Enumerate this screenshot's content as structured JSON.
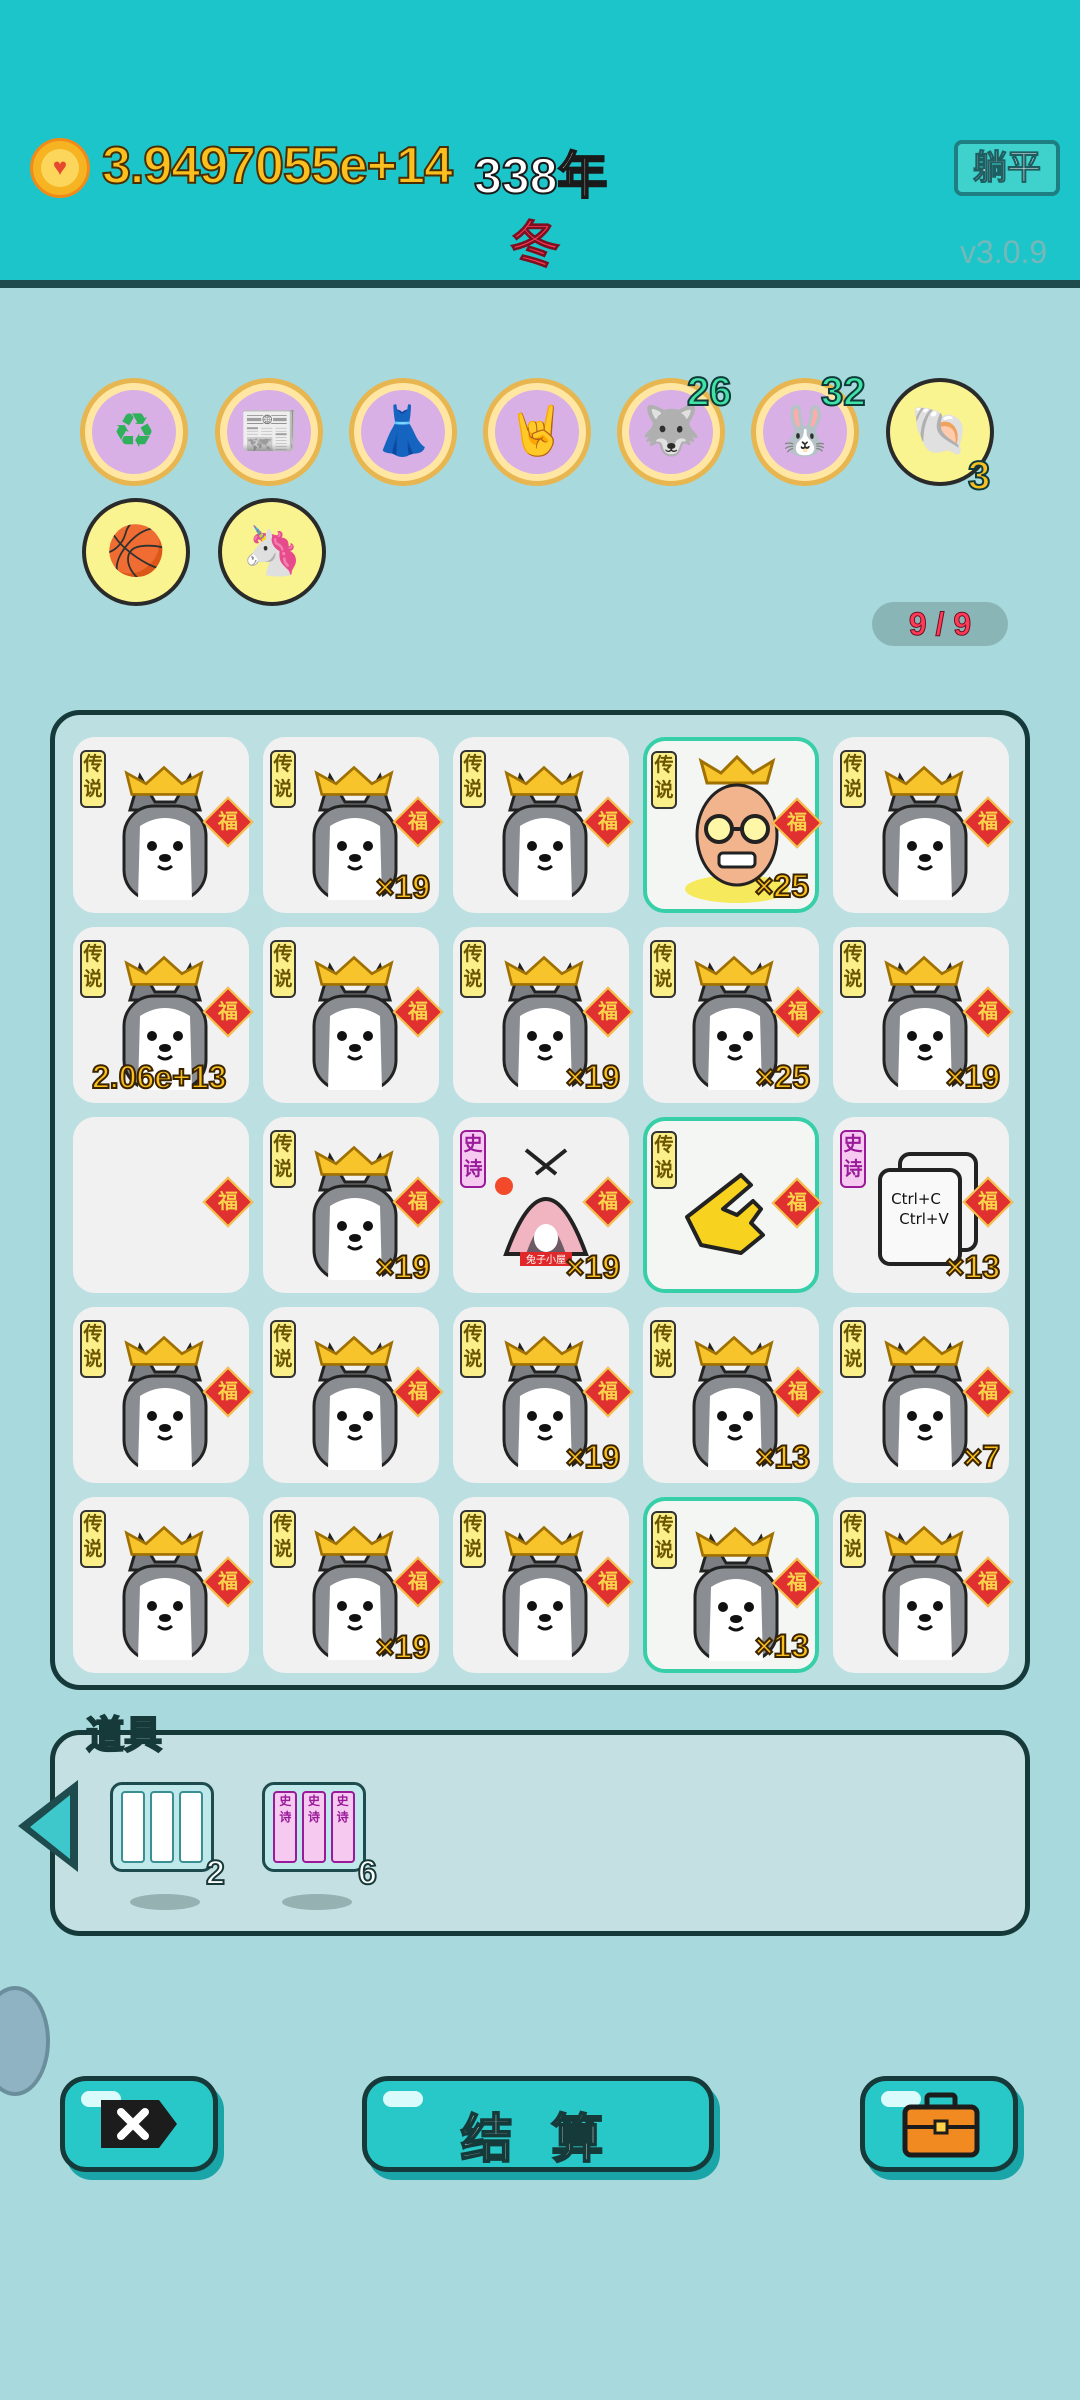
{
  "header": {
    "coin_amount": "3.9497055e+14",
    "year": "338年",
    "season": "冬",
    "lie_flat_label": "躺平",
    "version": "v3.0.9"
  },
  "relics": [
    {
      "name": "recycle-icon"
    },
    {
      "name": "time-magazine-icon"
    },
    {
      "name": "skirt-icon"
    },
    {
      "name": "rock-hand-icon"
    },
    {
      "name": "husky-relic-icon",
      "badge": "26"
    },
    {
      "name": "rabbit-relic-icon",
      "badge": "32"
    },
    {
      "name": "shell-icon",
      "badge": "3"
    },
    {
      "name": "basketballs-icon"
    },
    {
      "name": "unicorn-icon"
    }
  ],
  "floor_counter": "9 / 9",
  "board": {
    "rows": [
      [
        {
          "type": "husky",
          "rarity": "传说",
          "count": ""
        },
        {
          "type": "husky",
          "rarity": "传说",
          "count": "×19"
        },
        {
          "type": "husky",
          "rarity": "传说",
          "count": ""
        },
        {
          "type": "bald-man",
          "rarity": "传说",
          "count": "×25",
          "highlight": true
        },
        {
          "type": "husky",
          "rarity": "传说",
          "count": ""
        }
      ],
      [
        {
          "type": "husky",
          "rarity": "传说",
          "count": "2.06e+13"
        },
        {
          "type": "husky",
          "rarity": "传说",
          "count": ""
        },
        {
          "type": "husky",
          "rarity": "传说",
          "count": "×19"
        },
        {
          "type": "husky",
          "rarity": "传说",
          "count": "×25"
        },
        {
          "type": "husky",
          "rarity": "传说",
          "count": "×19"
        }
      ],
      [
        {
          "type": "empty",
          "rarity": "",
          "count": ""
        },
        {
          "type": "husky",
          "rarity": "传说",
          "count": "×19"
        },
        {
          "type": "rabbit-house",
          "rarity": "史诗",
          "count": "×19"
        },
        {
          "type": "pointing-hand",
          "rarity": "传说",
          "count": "",
          "highlight": true
        },
        {
          "type": "copy-paste",
          "rarity": "史诗",
          "count": "×13"
        }
      ],
      [
        {
          "type": "husky",
          "rarity": "传说",
          "count": ""
        },
        {
          "type": "husky",
          "rarity": "传说",
          "count": ""
        },
        {
          "type": "husky",
          "rarity": "传说",
          "count": "×19"
        },
        {
          "type": "husky",
          "rarity": "传说",
          "count": "×13"
        },
        {
          "type": "husky",
          "rarity": "传说",
          "count": "×7"
        }
      ],
      [
        {
          "type": "husky",
          "rarity": "传说",
          "count": ""
        },
        {
          "type": "husky",
          "rarity": "传说",
          "count": "×19"
        },
        {
          "type": "husky",
          "rarity": "传说",
          "count": ""
        },
        {
          "type": "husky",
          "rarity": "传说",
          "count": "×13",
          "highlight": true
        },
        {
          "type": "husky",
          "rarity": "传说",
          "count": ""
        }
      ]
    ],
    "fu_label": "福",
    "copy_text": [
      "Ctrl+C",
      "Ctrl+V"
    ],
    "rabbit_house_sign": "兔子小屋"
  },
  "props": {
    "title": "道具",
    "items": [
      {
        "name": "blank-reroll",
        "qty": "2",
        "slot_labels": [
          "",
          "",
          ""
        ]
      },
      {
        "name": "epic-reroll",
        "qty": "6",
        "slot_labels": [
          "史诗",
          "史诗",
          "史诗"
        ]
      }
    ]
  },
  "buttons": {
    "settle_label": "结 算"
  },
  "colors": {
    "accent": "#1cc5c9",
    "background": "#a7d9dd",
    "coin": "#fbbf1f",
    "season": "#ff3b58"
  }
}
